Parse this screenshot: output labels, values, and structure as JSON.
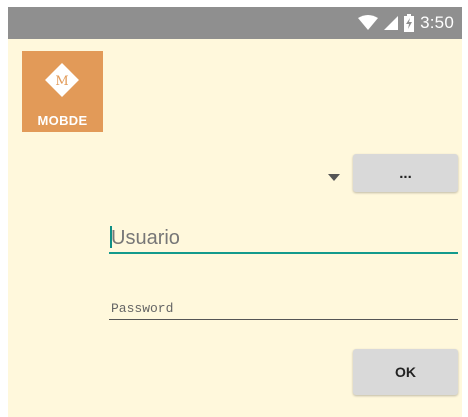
{
  "status_bar": {
    "time": "3:50",
    "icons": [
      "wifi-icon",
      "signal-icon",
      "battery-charging-icon"
    ]
  },
  "logo": {
    "letter": "M",
    "text": "MOBDE"
  },
  "server_selector": {
    "more_button_label": "..."
  },
  "login": {
    "username_placeholder": "Usuario",
    "username_value": "",
    "password_placeholder": "Password",
    "password_value": "",
    "ok_label": "OK"
  },
  "colors": {
    "background": "#fff8dc",
    "status_bar": "#8f8f8f",
    "logo": "#e29a58",
    "accent": "#139a8c",
    "button": "#d9d9d9"
  }
}
